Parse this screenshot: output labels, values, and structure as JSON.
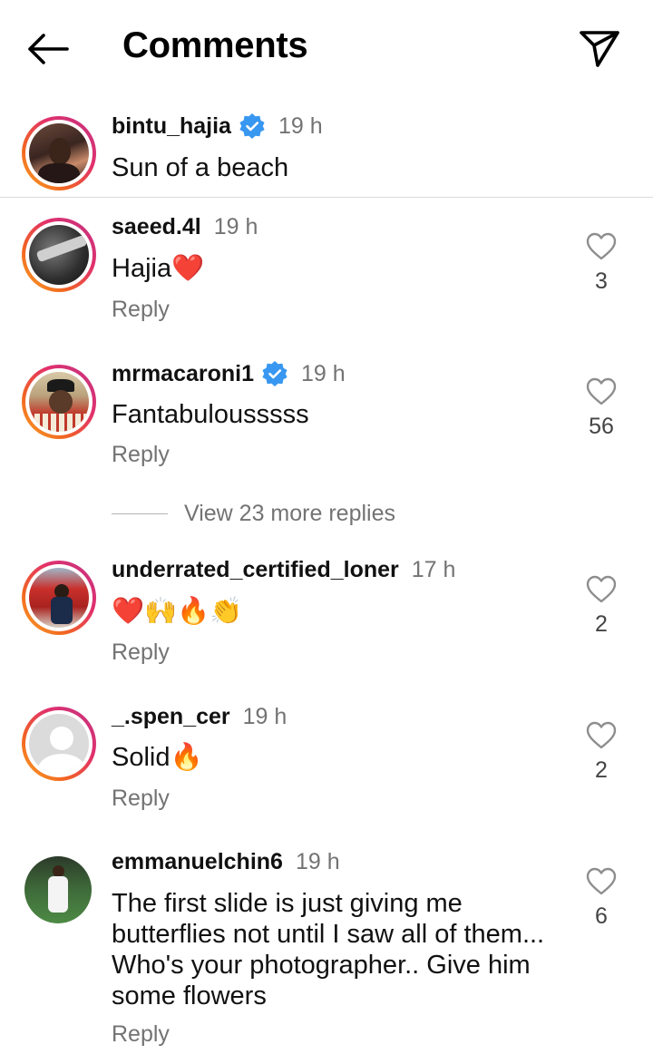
{
  "header": {
    "title": "Comments",
    "back_icon": "arrow-left-icon",
    "send_icon": "paper-plane-icon"
  },
  "caption": {
    "username": "bintu_hajia",
    "verified": true,
    "time": "19 h",
    "text": "Sun of a beach"
  },
  "comments": [
    {
      "username": "saeed.4l",
      "verified": false,
      "time": "19 h",
      "text": "Hajia❤️",
      "reply": "Reply",
      "likes": "3"
    },
    {
      "username": "mrmacaroni1",
      "verified": true,
      "time": "19 h",
      "text": "Fantabulousssss",
      "reply": "Reply",
      "likes": "56"
    },
    {
      "username": "underrated_certified_loner",
      "verified": false,
      "time": "17 h",
      "text": "❤️🙌🔥👏",
      "reply": "Reply",
      "likes": "2"
    },
    {
      "username": "_.spen_cer",
      "verified": false,
      "time": "19 h",
      "text": "Solid🔥",
      "reply": "Reply",
      "likes": "2"
    },
    {
      "username": "emmanuelchin6",
      "verified": false,
      "time": "19 h",
      "text": "The first slide is just giving me butterflies not until I saw all of them... Who's your photographer.. Give him some flowers",
      "reply": "Reply",
      "likes": "6"
    }
  ],
  "view_more": {
    "label": "View 23 more replies"
  },
  "colors": {
    "verified_blue": "#3897f0",
    "muted_text": "#737373",
    "ring_start": "#f9a825",
    "ring_end": "#c13584"
  }
}
